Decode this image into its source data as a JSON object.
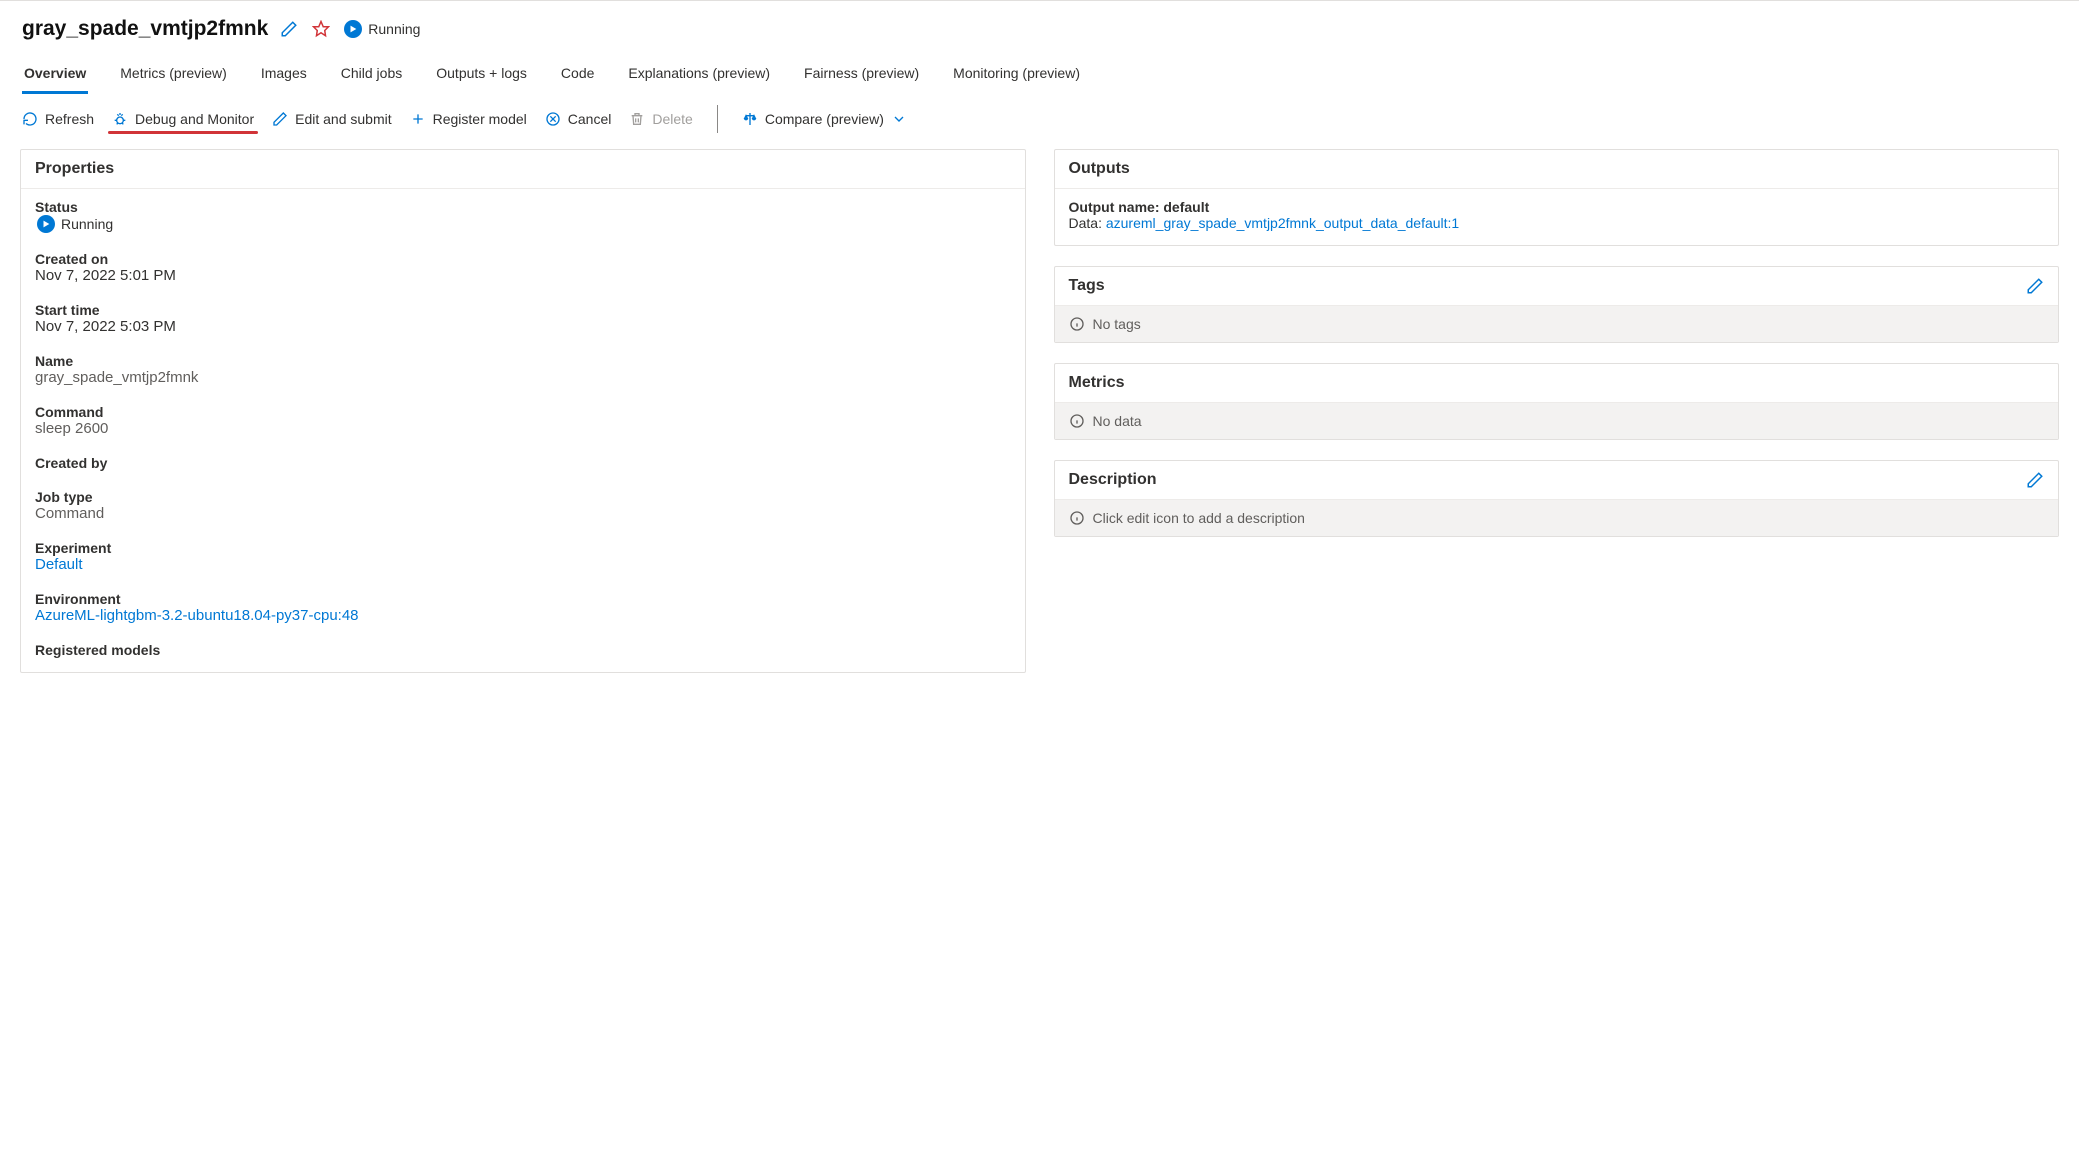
{
  "header": {
    "title": "gray_spade_vmtjp2fmnk",
    "status_label": "Running"
  },
  "tabs": [
    {
      "label": "Overview",
      "active": true
    },
    {
      "label": "Metrics (preview)"
    },
    {
      "label": "Images"
    },
    {
      "label": "Child jobs"
    },
    {
      "label": "Outputs + logs"
    },
    {
      "label": "Code"
    },
    {
      "label": "Explanations (preview)"
    },
    {
      "label": "Fairness (preview)"
    },
    {
      "label": "Monitoring (preview)"
    }
  ],
  "toolbar": {
    "refresh": "Refresh",
    "debug": "Debug and Monitor",
    "edit": "Edit and submit",
    "register": "Register model",
    "cancel": "Cancel",
    "delete": "Delete",
    "compare": "Compare (preview)"
  },
  "properties": {
    "title": "Properties",
    "status_label": "Status",
    "status_value": "Running",
    "created_on_label": "Created on",
    "created_on_value": "Nov 7, 2022 5:01 PM",
    "start_time_label": "Start time",
    "start_time_value": "Nov 7, 2022 5:03 PM",
    "name_label": "Name",
    "name_value": "gray_spade_vmtjp2fmnk",
    "command_label": "Command",
    "command_value": "sleep 2600",
    "created_by_label": "Created by",
    "created_by_value": "",
    "job_type_label": "Job type",
    "job_type_value": "Command",
    "experiment_label": "Experiment",
    "experiment_value": "Default",
    "environment_label": "Environment",
    "environment_value": "AzureML-lightgbm-3.2-ubuntu18.04-py37-cpu:48",
    "registered_models_label": "Registered models"
  },
  "outputs": {
    "title": "Outputs",
    "name_label": "Output name: default",
    "data_label": "Data: ",
    "data_link": "azureml_gray_spade_vmtjp2fmnk_output_data_default:1"
  },
  "tags": {
    "title": "Tags",
    "empty": "No tags"
  },
  "metrics": {
    "title": "Metrics",
    "empty": "No data"
  },
  "description": {
    "title": "Description",
    "empty": "Click edit icon to add a description"
  }
}
